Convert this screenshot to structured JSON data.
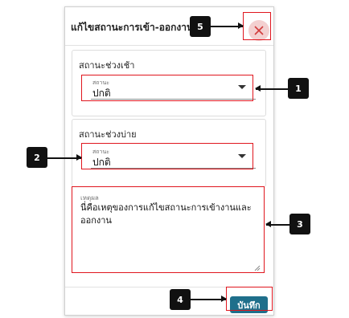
{
  "dialog": {
    "title": "แก้ไขสถานะการเข้า-ออกงาน",
    "close_icon": "close-icon"
  },
  "morning": {
    "card_label": "สถานะช่วงเช้า",
    "field_label": "สถานะ",
    "value": "ปกติ"
  },
  "afternoon": {
    "card_label": "สถานะช่วงบ่าย",
    "field_label": "สถานะ",
    "value": "ปกติ"
  },
  "reason": {
    "label": "เหตุผล",
    "value": "นี่คือเหตุของการแก้ไขสถานะการเข้างานและออกงาน"
  },
  "footer": {
    "save_label": "บันทึก"
  },
  "annotations": {
    "marker_1": "1",
    "marker_2": "2",
    "marker_3": "3",
    "marker_4": "4",
    "marker_5": "5"
  },
  "colors": {
    "highlight": "#e0161e",
    "save_button": "#1f6f8b",
    "close_button_bg": "#f3d0d0",
    "close_icon": "#d23b3b"
  }
}
